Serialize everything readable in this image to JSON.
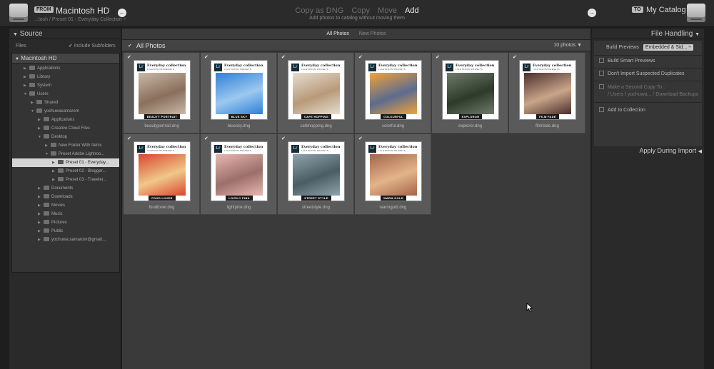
{
  "topbar": {
    "from_tag": "FROM",
    "source_title": "Macintosh HD",
    "source_caret": "÷",
    "source_path": "...tosh / Preset 01 - Everyday Collection ÷",
    "modes": [
      "Copy as DNG",
      "Copy",
      "Move",
      "Add"
    ],
    "active_mode": "Add",
    "mode_description": "Add photos to catalog without moving them",
    "to_tag": "TO",
    "dest_title": "My Catalog",
    "left_arrow_icon": "arrow-left-icon",
    "right_arrow_icon": "arrow-right-icon"
  },
  "source_panel": {
    "title": "Source",
    "files_label": "Files",
    "include_subfolders": "Include Subfolders",
    "root": "Macintosh HD",
    "tree": [
      {
        "label": "Applications",
        "indent": 1,
        "expanded": false
      },
      {
        "label": "Library",
        "indent": 1,
        "expanded": false
      },
      {
        "label": "System",
        "indent": 1,
        "expanded": false
      },
      {
        "label": "Users",
        "indent": 1,
        "expanded": true
      },
      {
        "label": "Shared",
        "indent": 2,
        "expanded": false
      },
      {
        "label": "yochuwasamarom",
        "indent": 2,
        "expanded": true
      },
      {
        "label": "Applications",
        "indent": 3,
        "expanded": false
      },
      {
        "label": "Creative Cloud Files",
        "indent": 3,
        "expanded": false
      },
      {
        "label": "Desktop",
        "indent": 3,
        "expanded": true
      },
      {
        "label": "New Folder With Items",
        "indent": 4,
        "expanded": false
      },
      {
        "label": "Preset Adobe Lightroo...",
        "indent": 4,
        "expanded": true
      },
      {
        "label": "Preset 01 - Everyday...",
        "indent": 5,
        "expanded": false,
        "selected": true
      },
      {
        "label": "Preset 02 - Blogger...",
        "indent": 5,
        "expanded": false
      },
      {
        "label": "Preset 03 - Traveler...",
        "indent": 5,
        "expanded": false
      },
      {
        "label": "Documents",
        "indent": 3,
        "expanded": false
      },
      {
        "label": "Downloads",
        "indent": 3,
        "expanded": false
      },
      {
        "label": "Movies",
        "indent": 3,
        "expanded": false
      },
      {
        "label": "Music",
        "indent": 3,
        "expanded": false
      },
      {
        "label": "Pictures",
        "indent": 3,
        "expanded": false
      },
      {
        "label": "Public",
        "indent": 3,
        "expanded": false
      },
      {
        "label": "yochuwa.samarom@gmail....",
        "indent": 3,
        "expanded": false
      }
    ]
  },
  "center": {
    "filters": [
      "All Photos",
      "New Photos"
    ],
    "active_filter": "All Photos",
    "grid_title": "All Photos",
    "photo_count": "10 photos",
    "photos": [
      {
        "file": "beautyportrait.dng",
        "label": "BEAUTY PORTRAIT",
        "bg": "#c9b8a8",
        "fg": "#8a6f5c"
      },
      {
        "file": "bluesky.dng",
        "label": "BLUE SKY",
        "bg": "#2f7fd6",
        "fg": "#9cc8f0"
      },
      {
        "file": "cafehopping.dng",
        "label": "CAFE HOPPING",
        "bg": "#e7ddd0",
        "fg": "#b89a7a"
      },
      {
        "file": "colorful.dng",
        "label": "COLOURFUL",
        "bg": "#f2a23a",
        "fg": "#5b6c8f"
      },
      {
        "file": "exploror.dng",
        "label": "EXPLOROR",
        "bg": "#6f7a6a",
        "fg": "#2d3a2a"
      },
      {
        "file": "filmfade.dng",
        "label": "FILM FADE",
        "bg": "#4a2f2a",
        "fg": "#c9a58a"
      },
      {
        "file": "foodlover.dng",
        "label": "FOOD LOVER",
        "bg": "#d9462e",
        "fg": "#f0c78a"
      },
      {
        "file": "lightpink.dng",
        "label": "LOVELY PINK",
        "bg": "#e9b7b1",
        "fg": "#9b6f6a"
      },
      {
        "file": "streetstyle.dng",
        "label": "STREET STYLE",
        "bg": "#8fa4ad",
        "fg": "#4b5c63"
      },
      {
        "file": "warmgold.dng",
        "label": "WARM GOLD",
        "bg": "#a5644a",
        "fg": "#e3b48a"
      }
    ],
    "thumb_collection": "Everyday collection",
    "thumb_subtitle": "LIGHTROOM PRESETS",
    "thumb_logo": "Lr"
  },
  "right_panel": {
    "title": "File Handling",
    "build_previews_label": "Build Previews",
    "build_previews_value": "Embedded & Sid... ÷",
    "options": [
      "Build Smart Previews",
      "Don't Import Suspected Duplicates"
    ],
    "second_copy_label": "Make a Second Copy To :",
    "second_copy_path": "/ Users / yochuwa... / Download Backups",
    "add_collection": "Add to Collection",
    "apply_during_import": "Apply During Import"
  },
  "colors": {
    "accent_lr": "#6fc4f2",
    "bg": "#1e1e1e",
    "panel": "#2a2a2a",
    "grid": "#3a3a3a"
  }
}
